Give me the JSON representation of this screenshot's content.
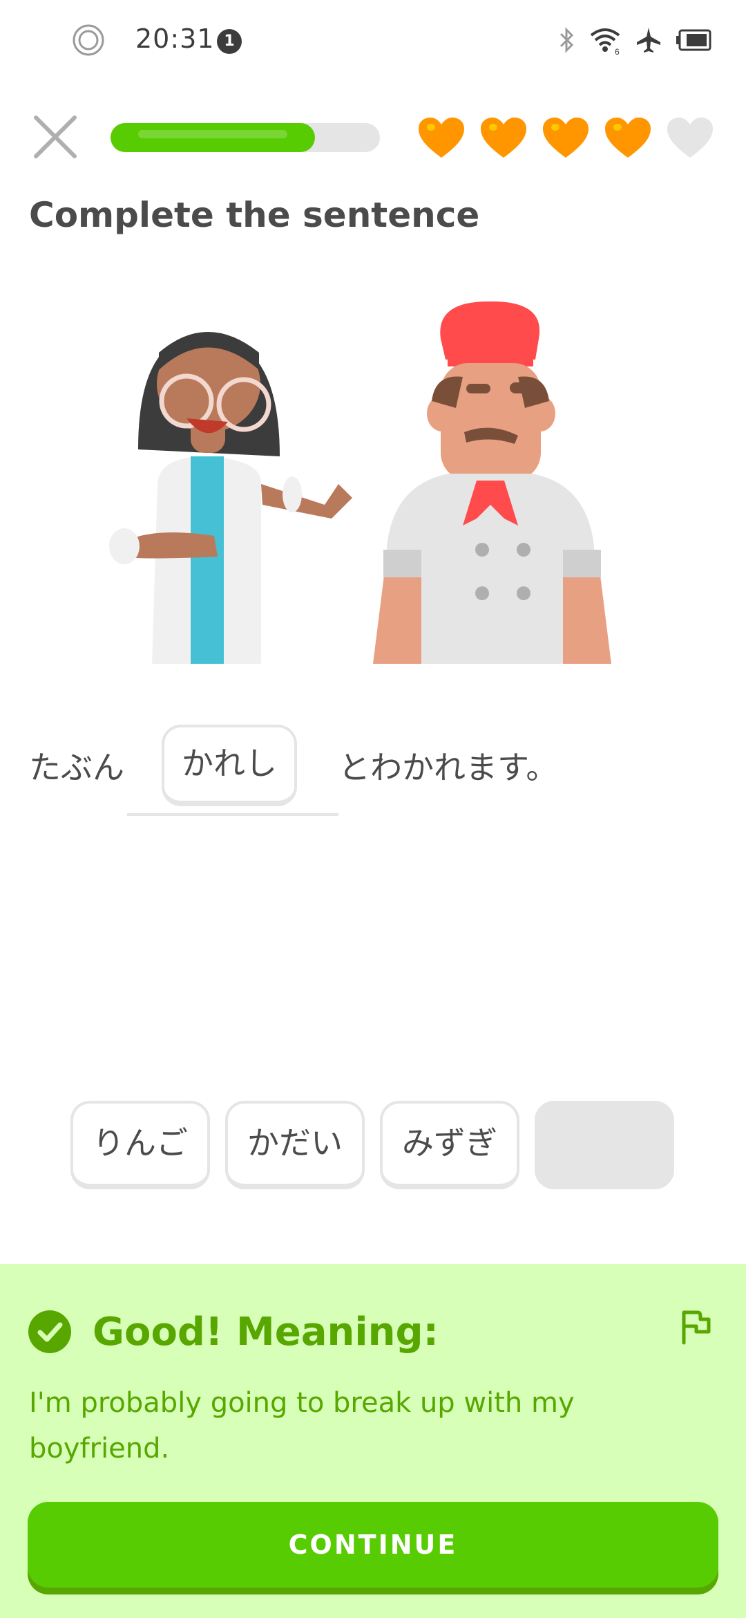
{
  "status_bar": {
    "time": "20:31",
    "notification_count": "1",
    "icons": [
      "record-icon",
      "bluetooth-icon",
      "wifi-icon",
      "airplane-mode-icon",
      "battery-icon"
    ]
  },
  "lesson": {
    "progress": 0.76,
    "hearts_total": 5,
    "hearts_filled": 4,
    "colors": {
      "progress": "#58cc02",
      "heart": "#ff9600",
      "heart_empty": "#e5e5e5"
    }
  },
  "exercise": {
    "title": "Complete the sentence",
    "sentence_before": "たぶん",
    "answer": "かれし",
    "sentence_after": "とわかれます。",
    "word_bank": [
      "りんご",
      "かだい",
      "みずぎ"
    ]
  },
  "feedback": {
    "title": "Good! Meaning:",
    "text": "I'm probably going to break up with my boyfriend.",
    "continue_label": "CONTINUE",
    "colors": {
      "panel": "#d7ffb8",
      "text": "#58a700",
      "button": "#58cc02"
    }
  }
}
